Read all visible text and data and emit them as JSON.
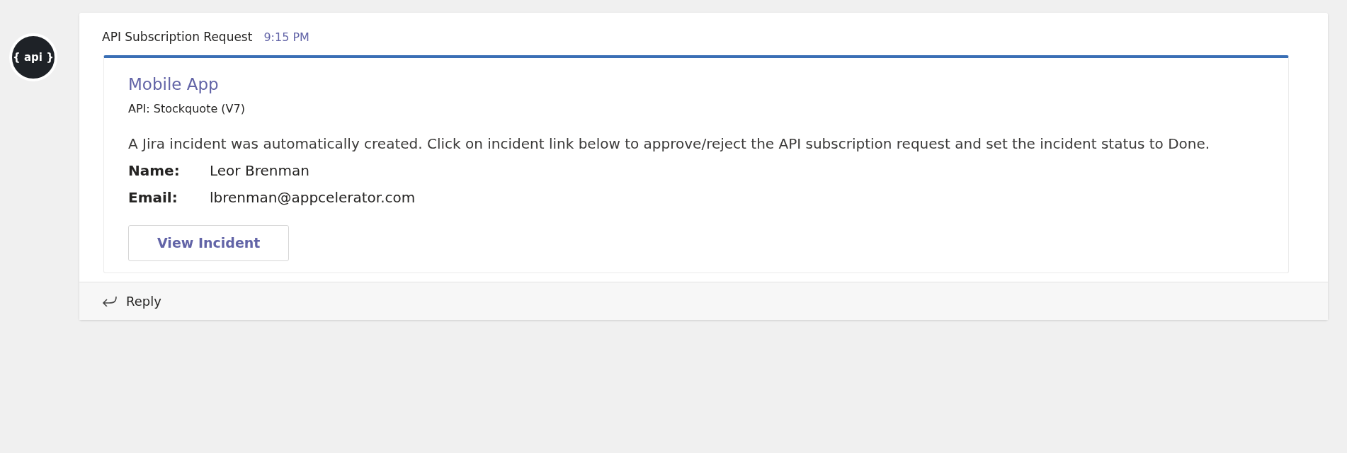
{
  "avatar": {
    "label": "{ api }"
  },
  "message": {
    "sender": "API Subscription Request",
    "time": "9:15 PM"
  },
  "card": {
    "title": "Mobile App",
    "subtitle": "API: Stockquote (V7)",
    "body": "A Jira incident was automatically created. Click on incident link below to approve/reject the API subscription request and set the incident status to Done.",
    "facts": [
      {
        "label": "Name:",
        "value": "Leor Brenman"
      },
      {
        "label": "Email:",
        "value": "lbrenman@appcelerator.com"
      }
    ],
    "actions": [
      "View Incident"
    ]
  },
  "reply": {
    "label": "Reply"
  }
}
